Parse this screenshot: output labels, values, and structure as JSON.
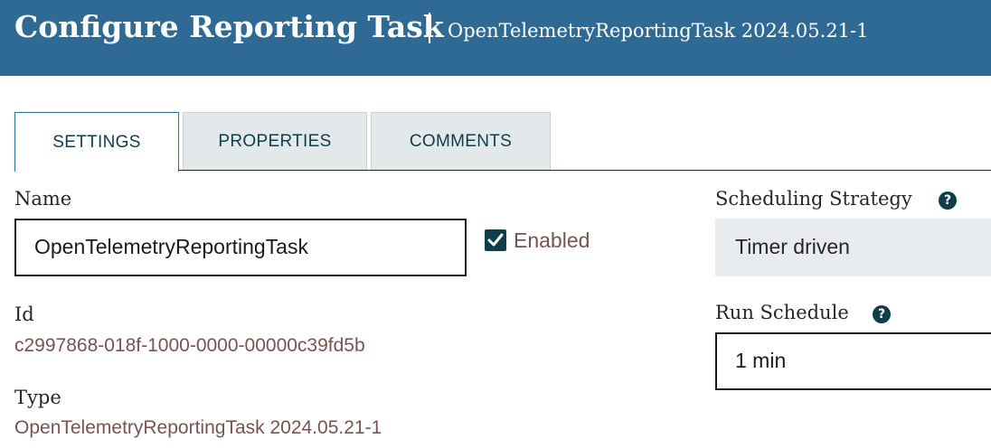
{
  "header": {
    "title": "Configure Reporting Task",
    "subtitle": "OpenTelemetryReportingTask 2024.05.21-1"
  },
  "tabs": [
    {
      "label": "SETTINGS",
      "active": true
    },
    {
      "label": "PROPERTIES",
      "active": false
    },
    {
      "label": "COMMENTS",
      "active": false
    }
  ],
  "settings": {
    "name_label": "Name",
    "name_value": "OpenTelemetryReportingTask",
    "enabled_label": "Enabled",
    "enabled_checked": true,
    "id_label": "Id",
    "id_value": "c2997868-018f-1000-0000-00000c39fd5b",
    "type_label": "Type",
    "type_value": "OpenTelemetryReportingTask 2024.05.21-1",
    "scheduling_strategy_label": "Scheduling Strategy",
    "scheduling_strategy_value": "Timer driven",
    "run_schedule_label": "Run Schedule",
    "run_schedule_value": "1 min",
    "help_icon": "question-circle-icon",
    "checkbox_icon": "checkmark-icon"
  },
  "colors": {
    "header_bg": "#2e6a94",
    "value_text": "#775351",
    "accent_dark": "#0f3d4c"
  }
}
